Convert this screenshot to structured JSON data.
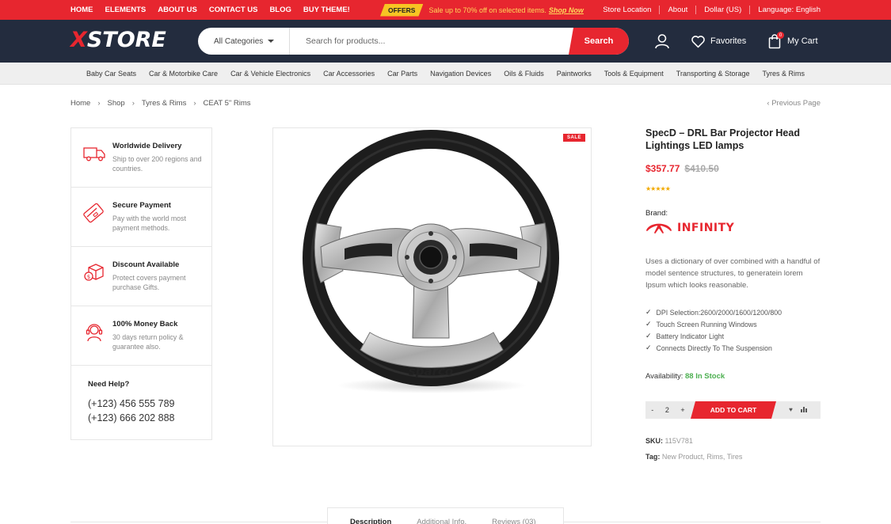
{
  "topbar": {
    "nav": [
      "HOME",
      "ELEMENTS",
      "ABOUT US",
      "CONTACT US",
      "BLOG",
      "BUY THEME!"
    ],
    "offers_badge": "OFFERS",
    "offers_text": "Sale up to 70% off on selected items.",
    "offers_link": "Shop Now",
    "right": [
      "Store Location",
      "About",
      "Dollar (US)",
      "Language: English"
    ]
  },
  "header": {
    "logo_x": "X",
    "logo_rest": "STORE",
    "search_category": "All Categories",
    "search_placeholder": "Search for products...",
    "search_button": "Search",
    "favorites": "Favorites",
    "cart": "My Cart",
    "cart_count": "0"
  },
  "categories": [
    "Baby Car Seats",
    "Car & Motorbike Care",
    "Car & Vehicle Electronics",
    "Car Accessories",
    "Car Parts",
    "Navigation Devices",
    "Oils & Fluids",
    "Paintworks",
    "Tools & Equipment",
    "Transporting & Storage",
    "Tyres & Rims"
  ],
  "breadcrumb": [
    "Home",
    "Shop",
    "Tyres & Rims",
    "CEAT 5\" Rims"
  ],
  "previous_page": "Previous Page",
  "features": [
    {
      "icon": "truck-icon",
      "title": "Worldwide Delivery",
      "desc": "Ship to over 200 regions and countries."
    },
    {
      "icon": "credit-card-icon",
      "title": "Secure Payment",
      "desc": "Pay with the world most payment methods."
    },
    {
      "icon": "discount-box-icon",
      "title": "Discount Available",
      "desc": "Protect covers payment purchase Gifts."
    },
    {
      "icon": "headset-icon",
      "title": "100% Money Back",
      "desc": "30 days return policy & guarantee also."
    }
  ],
  "help": {
    "title": "Need Help?",
    "phone1": "(+123) 456 555 789",
    "phone2": "(+123) 666 202 888"
  },
  "product": {
    "sale_badge": "SALE",
    "image_brand_text": "sparco",
    "title": "SpecD – DRL Bar Projector Head Lightings LED lamps",
    "price": "$357.77",
    "old_price": "$410.50",
    "rating": 5,
    "brand_label": "Brand:",
    "brand_name": "INFINITY",
    "description": "Uses a dictionary of over combined with a handful of model sentence structures, to generatein lorem Ipsum which looks reasonable.",
    "bullets": [
      "DPI Selection:2600/2000/1600/1200/800",
      "Touch Screen Running Windows",
      "Battery Indicator Light",
      "Connects Directly To The Suspension"
    ],
    "availability_label": "Availability:",
    "availability_value": "88 In Stock",
    "qty_minus": "-",
    "qty": "2",
    "qty_plus": "+",
    "add_to_cart": "ADD TO CART",
    "sku_label": "SKU:",
    "sku": "115V781",
    "tag_label": "Tag:",
    "tags": "New Product, Rims, Tires"
  },
  "tabs": [
    "Description",
    "Additional Info.",
    "Reviews (03)"
  ],
  "colors": {
    "brand_red": "#e7262f",
    "header_navy": "#232c3e",
    "offers_yellow": "#f7c423",
    "stock_green": "#4caf50"
  }
}
